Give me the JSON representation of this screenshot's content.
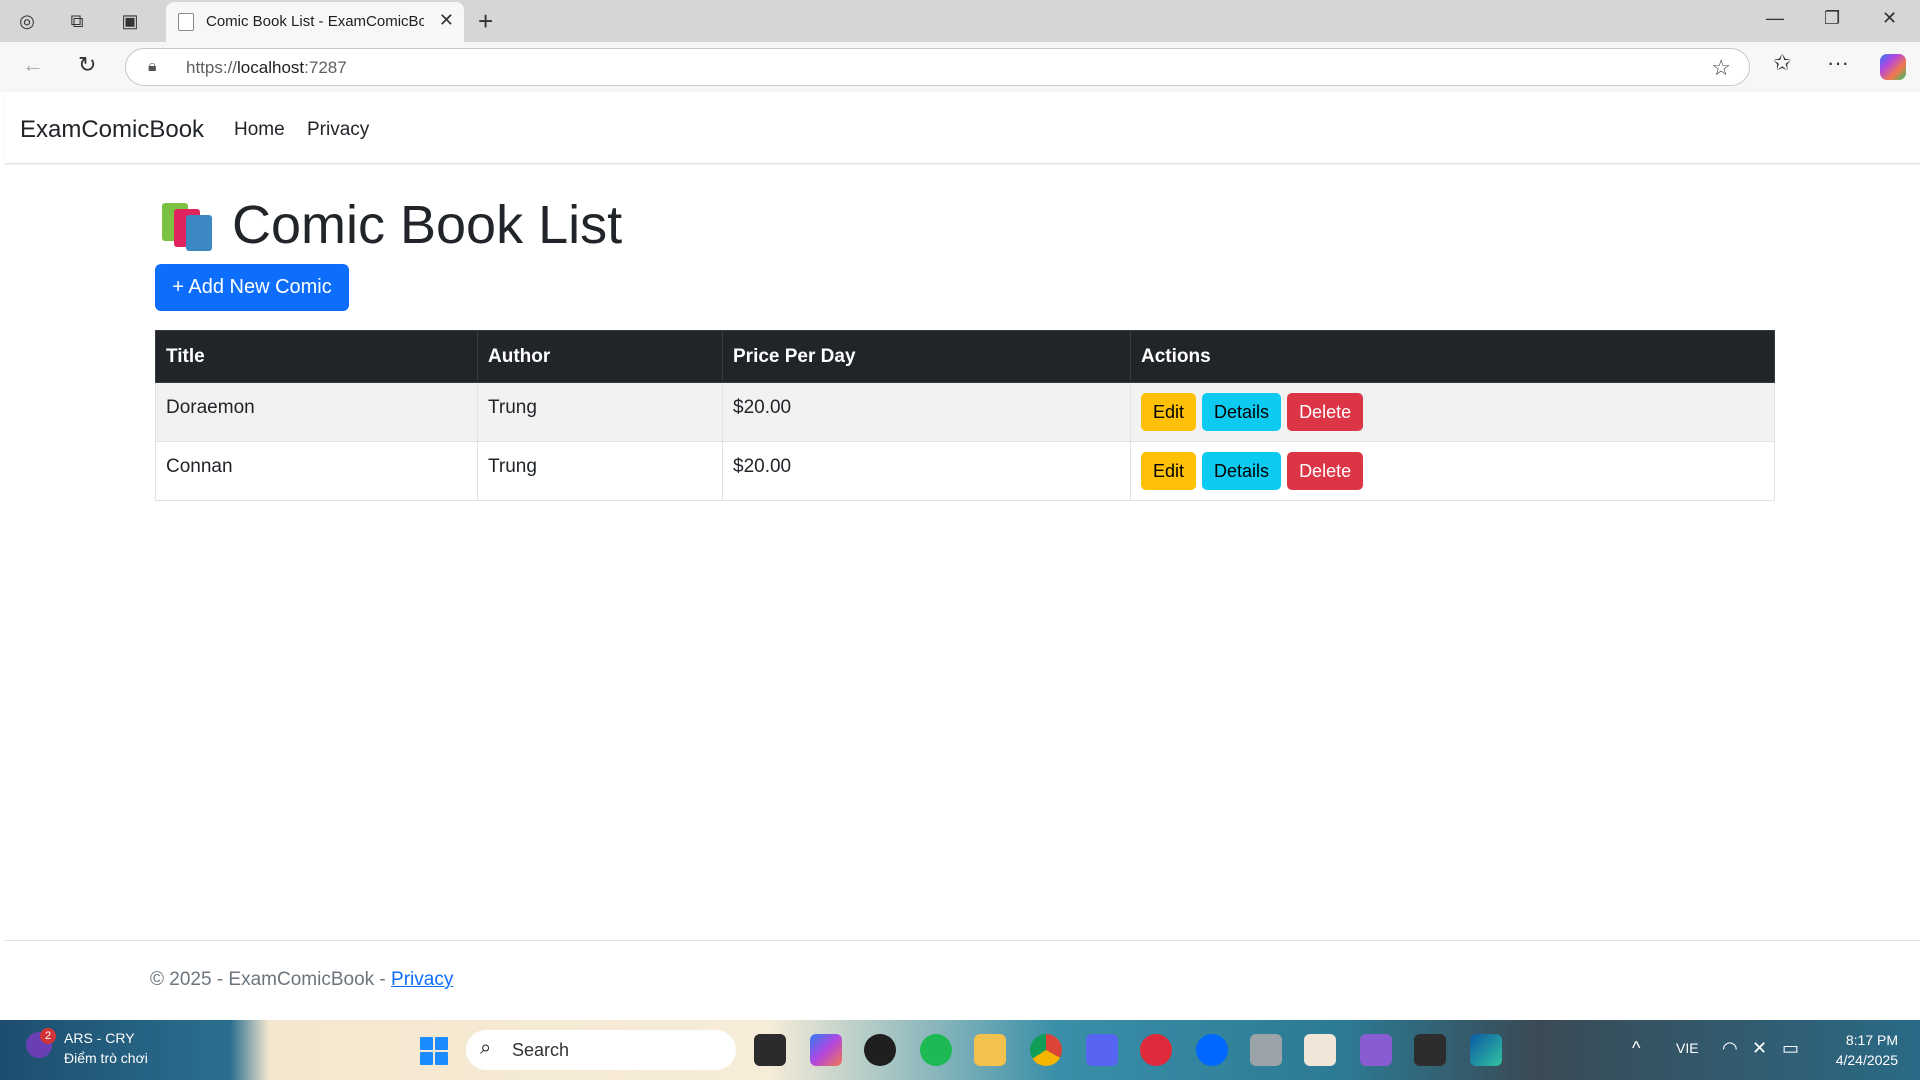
{
  "browser": {
    "tab_title": "Comic Book List - ExamComicBook",
    "url_prefix": "https://",
    "url_host": "localhost",
    "url_port": ":7287"
  },
  "navbar": {
    "brand": "ExamComicBook",
    "links": [
      "Home",
      "Privacy"
    ]
  },
  "page": {
    "title": "Comic Book List",
    "title_icon": "books-icon",
    "add_button": "+ Add New Comic"
  },
  "table": {
    "headers": [
      "Title",
      "Author",
      "Price Per Day",
      "Actions"
    ],
    "rows": [
      {
        "title": "Doraemon",
        "author": "Trung",
        "price": "$20.00"
      },
      {
        "title": "Connan",
        "author": "Trung",
        "price": "$20.00"
      }
    ],
    "actions": {
      "edit": "Edit",
      "details": "Details",
      "delete": "Delete"
    }
  },
  "footer": {
    "text": "© 2025 - ExamComicBook - ",
    "link": "Privacy"
  },
  "taskbar": {
    "weather_line1": "ARS - CRY",
    "weather_line2": "Điểm trò chơi",
    "badge": "2",
    "search": "Search",
    "lang": "VIE",
    "time": "8:17 PM",
    "date": "4/24/2025"
  },
  "colors": {
    "primary": "#0d6efd",
    "warning": "#ffc107",
    "info": "#0dcaf0",
    "danger": "#dc3545",
    "dark": "#212529"
  }
}
